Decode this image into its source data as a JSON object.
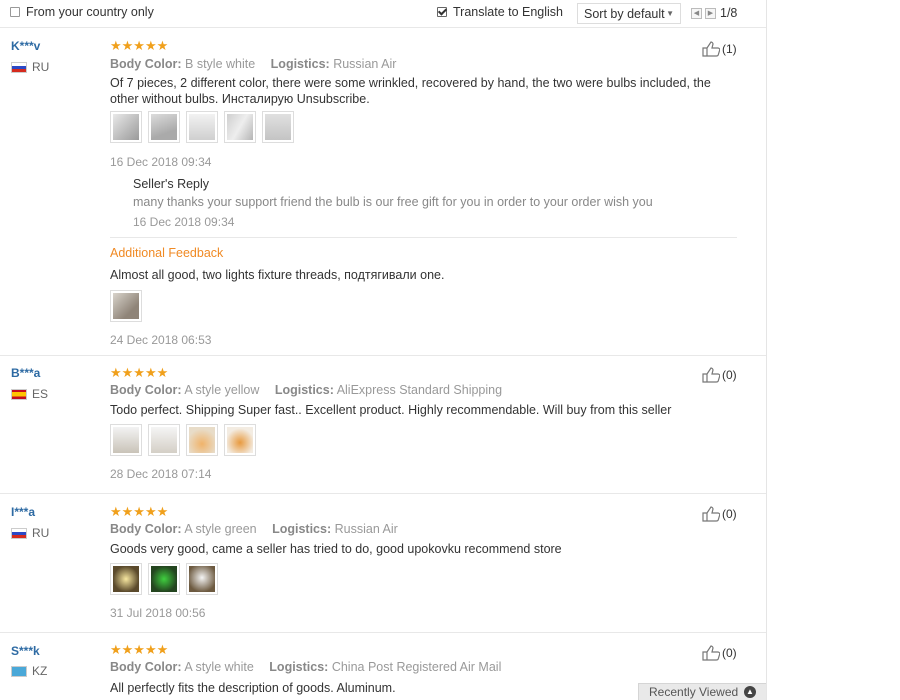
{
  "toolbar": {
    "from_country_label": "From your country only",
    "translate_label": "Translate to English",
    "sort_label": "Sort by default",
    "pager_prev": "◀",
    "pager_next": "▶",
    "pager_text": "1/8"
  },
  "labels": {
    "body_color": "Body Color:",
    "logistics": "Logistics:",
    "sellers_reply": "Seller's Reply",
    "additional_feedback": "Additional Feedback",
    "recently_viewed": "Recently Viewed"
  },
  "reviews": [
    {
      "name": "K***v",
      "country": "RU",
      "stars": "★★★★★",
      "body_color": "B style white",
      "logistics": "Russian Air",
      "text": "Of 7 pieces, 2 different color, there were some wrinkled, recovered by hand, the two were bulbs included, the other without bulbs. Инсталирую Unsubscribe.",
      "date": "16 Dec 2018 09:34",
      "helpful": "(1)",
      "reply_text": "many thanks your support friend the bulb is our free gift for you in order to your order wish you",
      "reply_date": "16 Dec 2018 09:34",
      "additional_text": "Almost all good, two lights fixture threads, подтягивали one.",
      "additional_date": "24 Dec 2018 06:53"
    },
    {
      "name": "B***a",
      "country": "ES",
      "stars": "★★★★★",
      "body_color": "A style yellow",
      "logistics": "AliExpress Standard Shipping",
      "text": "Todo perfect. Shipping Super fast.. Excellent product. Highly recommendable. Will buy from this seller",
      "date": "28 Dec 2018 07:14",
      "helpful": "(0)"
    },
    {
      "name": "I***a",
      "country": "RU",
      "stars": "★★★★★",
      "body_color": "A style green",
      "logistics": "Russian Air",
      "text": "Goods very good, came a seller has tried to do, good upokovku recommend store",
      "date": "31 Jul 2018 00:56",
      "helpful": "(0)"
    },
    {
      "name": "S***k",
      "country": "KZ",
      "stars": "★★★★★",
      "body_color": "A style white",
      "logistics": "China Post Registered Air Mail",
      "text": "All perfectly fits the description of goods. Aluminum.",
      "helpful": "(0)"
    }
  ],
  "colors": {
    "accent_orange": "#f08a24",
    "star": "#f0a01c",
    "name_blue": "#2d6aa3"
  }
}
